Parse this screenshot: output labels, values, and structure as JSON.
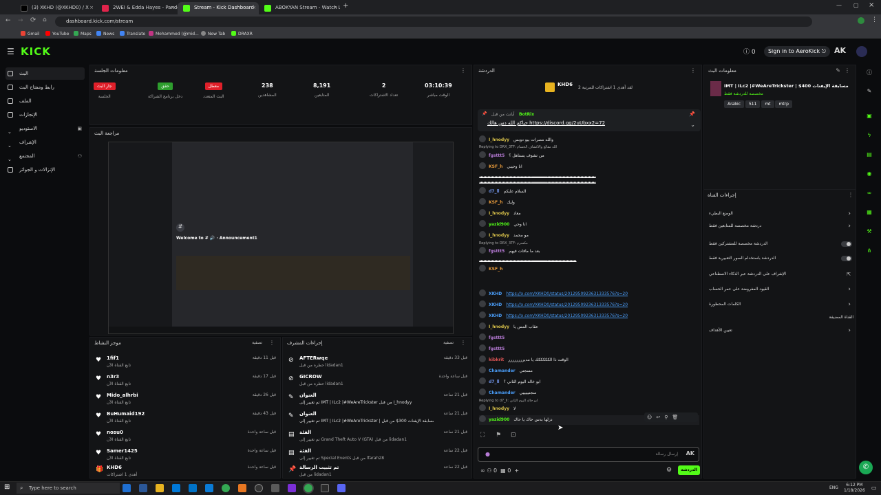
{
  "browser": {
    "tabs": [
      {
        "title": "(3) XKHD (@XKHD0) / X",
        "color": "#000000"
      },
      {
        "title": "2WEI & Edda Hayes - Pandora",
        "color": "#e0244b"
      },
      {
        "title": "Stream - Kick Dashboard",
        "color": "#53fc18",
        "active": true
      },
      {
        "title": "ABOKYAN Stream - Watch Live",
        "color": "#53fc18"
      }
    ],
    "url": "dashboard.kick.com/stream",
    "bookmarks": [
      "Gmail",
      "YouTube",
      "Maps",
      "News",
      "Translate",
      "Mohammed (@mid...",
      "New Tab",
      "DRAXR"
    ]
  },
  "header": {
    "logo": "KICK",
    "follow_count": "0",
    "signin": "Sign in to AeroKick",
    "colors": {
      "accent": "#53fc18"
    }
  },
  "sidebar": {
    "items": [
      {
        "label": "البث",
        "active": true
      },
      {
        "label": "رابط ومفتاح البث"
      },
      {
        "label": "الملف"
      },
      {
        "label": "الإنجازات"
      },
      {
        "label": "الاستوديو"
      },
      {
        "label": "الإشراف"
      },
      {
        "label": "المجتمع"
      },
      {
        "label": "الإنزالات و الجوائز"
      }
    ]
  },
  "session": {
    "title": "معلومات الجلسة",
    "badges": [
      "جار البث",
      "حقق",
      "معطل"
    ],
    "badge_labels": [
      "الجلسة",
      "دخل برنامج الشراكة",
      "البث المتعدد"
    ],
    "stats": [
      {
        "value": "238",
        "label": "المشاهدين"
      },
      {
        "value": "8,191",
        "label": "المتابعين"
      },
      {
        "value": "2",
        "label": "تعداد الاشتراكات"
      },
      {
        "value": "03:10:39",
        "label": "الوقت مباشر"
      }
    ]
  },
  "preview": {
    "title": "مراجعة البث",
    "welcome": "Welcome to # 🔊 · Announcement1"
  },
  "activity": {
    "title": "موجز النشاط",
    "filter": "تصفية",
    "items": [
      {
        "name": "1fif1",
        "sub": "تابع القناة الآن",
        "time": "قبل 11 دقيقة"
      },
      {
        "name": "n3r3",
        "sub": "تابع القناة الآن",
        "time": "قبل 17 دقيقة"
      },
      {
        "name": "Mido_alhrbi",
        "sub": "تابع القناة الآن",
        "time": "قبل 26 دقيقة"
      },
      {
        "name": "BuHumaid192",
        "sub": "تابع القناة الآن",
        "time": "قبل 43 دقيقة"
      },
      {
        "name": "nosu0",
        "sub": "تابع القناة الآن",
        "time": "قبل ساعة واحدة"
      },
      {
        "name": "Samer1425",
        "sub": "تابع القناة الآن",
        "time": "قبل ساعة واحدة"
      },
      {
        "name": "KHD6",
        "sub": "أهدى 1 اشتراكات",
        "time": "قبل ساعة واحدة"
      }
    ]
  },
  "modactions": {
    "title": "إجراءات المشرف",
    "filter": "تصفية",
    "items": [
      {
        "name": "AFTERwqe",
        "sub": "حظره من قبل lidadan1",
        "time": "قبل 33 دقيقة"
      },
      {
        "name": "GICROW",
        "sub": "حظره من قبل lidadan1",
        "time": "قبل ساعة واحدة"
      },
      {
        "name": "العنوان",
        "sub": "تم تغيير إلى IMT | ILc2 |#WeAreTrickster من قبل I_hnodyy",
        "time": "قبل 21 ساعة"
      },
      {
        "name": "العنوان",
        "sub": "تم تغيير إلى IMT | ILc2 |#WeAreTrickster | مسابقة الإيفنات 300$ من قبل XKHD",
        "time": "قبل 21 ساعة"
      },
      {
        "name": "الفئة",
        "sub": "تم تغيير إلى Grand Theft Auto V (GTA) من قبل lidadan1",
        "time": "قبل 21 ساعة"
      },
      {
        "name": "الفئة",
        "sub": "تم تغيير إلى Special Events من قبل lfarah28",
        "time": "قبل 22 ساعة"
      },
      {
        "name": "تم تثبيت الرسالة",
        "sub": "من قبل lidadan1",
        "time": "قبل 22 ساعة"
      }
    ]
  },
  "chat": {
    "title": "الدردشة",
    "top_user": "KHD6",
    "top_sub": "لقد أهدى 1 اشتراكات للمرتبة 2",
    "pinned_user": "BotRix",
    "pinned_text": "أيانت من قبل",
    "pinned_link": "حياكم الله دس هالك https://discord.gg/2uUbxx2=72",
    "messages": [
      {
        "user": "I_hnodyy",
        "color": "#d9c24a",
        "text": "والله مصرات بيو دوبس",
        "reply": "Replying to DRX_3TF: الله مقالع والاكشاف الحسام"
      },
      {
        "user": "fgsttt5",
        "color": "#b77bd6",
        "text": "من تشوف يستاهل ؟"
      },
      {
        "user": "KSF_h",
        "color": "#e89b3b",
        "text": "انا وحيني"
      },
      {
        "user": "d7_ll",
        "color": "#6c8fe0",
        "text": "السلام عليكم"
      },
      {
        "user": "KSF_h",
        "color": "#e89b3b",
        "text": "وليك"
      },
      {
        "user": "I_hnodyy",
        "color": "#d9c24a",
        "text": "معاد"
      },
      {
        "user": "yazid900",
        "color": "#53fc18",
        "text": "انا وحي"
      },
      {
        "user": "I_hnodyy",
        "color": "#d9c24a",
        "text": "مو محمد",
        "reply": "Replying to DRX_3TF: مكسرم"
      },
      {
        "user": "fgsttt5",
        "color": "#b77bd6",
        "text": "بعد ما مافات فيهم"
      },
      {
        "user": "KSF_h",
        "color": "#e89b3b",
        "text": ""
      },
      {
        "user": "XKHD",
        "color": "#4a9df8",
        "link": "https://x.com/XKHD0/status/2012950923631333576?s=20"
      },
      {
        "user": "XKHD",
        "color": "#4a9df8",
        "link": "https://x.com/XKHD0/status/2012950923631333576?s=20"
      },
      {
        "user": "XKHD",
        "color": "#4a9df8",
        "link": "https://x.com/XKHD0/status/2012950923631333576?s=20"
      },
      {
        "user": "I_hnodyy",
        "color": "#d9c24a",
        "text": "عقاب المس يا"
      },
      {
        "user": "fgsttt5",
        "color": "#b77bd6",
        "text": ""
      },
      {
        "user": "fgsttt5",
        "color": "#b77bd6",
        "text": ""
      },
      {
        "user": "kibkrit",
        "color": "#e05555",
        "text": "الوقت ذا الكككككك يا مديرررررررر"
      },
      {
        "user": "Chamander",
        "color": "#4a9df8",
        "text": "مسجني"
      },
      {
        "user": "d7_ll",
        "color": "#6c8fe0",
        "text": "ابو خاله اليوم الثاني ؟"
      },
      {
        "user": "Chamander",
        "color": "#4a9df8",
        "text": "سجنيييييي",
        "reply": "Replying to d7_ll: ابو خاله اليوم الثاني"
      },
      {
        "user": "I_hnodyy",
        "color": "#d9c24a",
        "text": "لا"
      },
      {
        "user": "yazid900",
        "color": "#53fc18",
        "text": "دزلها بدس حاك يا حاك"
      }
    ],
    "input_placeholder": "إرسال رسالة",
    "send": "الدردشة",
    "footer_count1": "0",
    "footer_count2": "0"
  },
  "stream_info": {
    "title": "معلومات البث",
    "stream_title": "IMT | ILc2 |#WeAreTrickster | $400 مسابقة الإيفنات",
    "category_note": "مخصصة للدردشة فقط",
    "tags": [
      "Arabic",
      "511",
      "mt",
      "mtrp"
    ]
  },
  "channel_actions": {
    "title": "إجراءات القناة",
    "items": [
      {
        "label": "الوضع البطيء",
        "control": "chevron"
      },
      {
        "label": "دردشة مخصصة للمتابعين فقط",
        "control": "chevron"
      },
      {
        "label": "الدردشة مخصصة للمشتركين فقط",
        "control": "toggle"
      },
      {
        "label": "الدردشة باستخدام الصور التعبيرية فقط",
        "control": "toggle"
      },
      {
        "label": "الإشراف على الدردشة عبر الذكاء الاصطناعي",
        "control": "external"
      },
      {
        "label": "القيود المفروضة على عمر الحساب",
        "control": "chevron"
      },
      {
        "label": "الكلمات المحظورة",
        "control": "chevron"
      },
      {
        "label": "القناة المضيفة",
        "control": "none"
      },
      {
        "label": "تعيين الأهداف",
        "control": "chevron"
      }
    ]
  },
  "taskbar": {
    "search": "Type here to search",
    "time": "6:12 PM",
    "date": "1/18/2026",
    "lang": "ENG"
  }
}
